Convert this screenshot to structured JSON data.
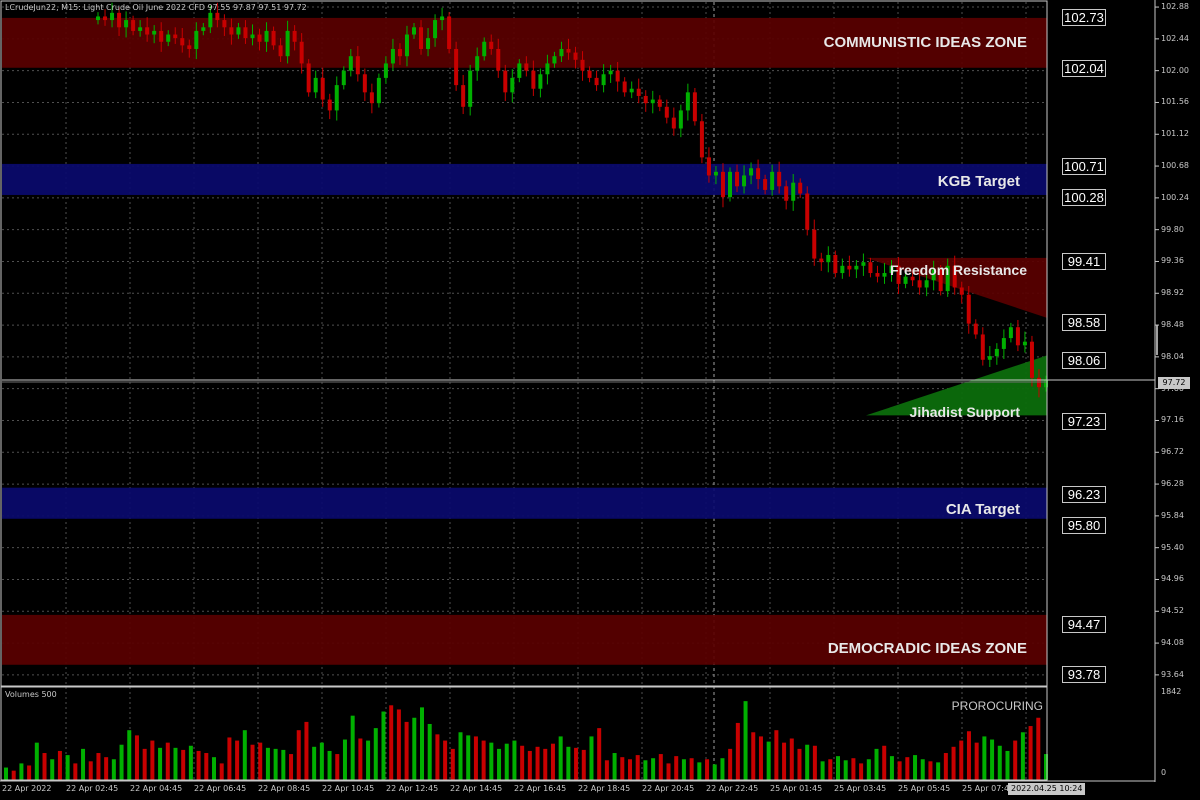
{
  "symbol_info": "LCrudeJun22, M15:  Light Crude Oil June 2022 CFD  97.55 97.87 97.51 97.72",
  "zones": [
    {
      "id": "communistic",
      "label": "COMMUNISTIC IDEAS ZONE",
      "color": "#5a0000",
      "price_top": 102.73,
      "price_bottom": 102.04
    },
    {
      "id": "kgb",
      "label": "KGB Target",
      "color": "#0a0a6e",
      "price_top": 100.71,
      "price_bottom": 100.28
    },
    {
      "id": "cia",
      "label": "CIA Target",
      "color": "#0a0a6e",
      "price_top": 96.23,
      "price_bottom": 95.8
    },
    {
      "id": "democradic",
      "label": "DEMOCRADIC IDEAS ZONE",
      "color": "#5a0000",
      "price_top": 94.47,
      "price_bottom": 93.78
    }
  ],
  "triangles": [
    {
      "id": "freedom",
      "label": "Freedom Resistance",
      "color": "#5a0000",
      "price_top": 99.41,
      "price_bottom": 98.58
    },
    {
      "id": "jihadist",
      "label": "Jihadist Support",
      "color": "#0c6d0c",
      "price_top": 98.06,
      "price_bottom": 97.23
    }
  ],
  "price_labels": [
    "102.73",
    "102.04",
    "100.71",
    "100.28",
    "99.41",
    "98.58",
    "98.06",
    "97.23",
    "96.23",
    "95.80",
    "94.47",
    "93.78"
  ],
  "price_axis": [
    "102.88",
    "102.44",
    "102.00",
    "101.56",
    "101.12",
    "100.68",
    "100.24",
    "99.80",
    "99.36",
    "98.92",
    "98.48",
    "98.04",
    "97.60",
    "97.16",
    "96.72",
    "96.28",
    "95.84",
    "95.40",
    "94.96",
    "94.52",
    "94.08",
    "93.64"
  ],
  "current_price": "97.72",
  "indicator": {
    "label": "Volumes 500",
    "tag": "PROROCURING",
    "axis_top": "1842",
    "axis_bottom": "0"
  },
  "time_axis": [
    "22 Apr 2022",
    "22 Apr 02:45",
    "22 Apr 04:45",
    "22 Apr 06:45",
    "22 Apr 08:45",
    "22 Apr 10:45",
    "22 Apr 12:45",
    "22 Apr 14:45",
    "22 Apr 16:45",
    "22 Apr 18:45",
    "22 Apr 20:45",
    "22 Apr 22:45",
    "25 Apr 01:45",
    "25 Apr 03:45",
    "25 Apr 05:45",
    "25 Apr 07:45"
  ],
  "time_cursor": "2022.04.25 10:24",
  "colors": {
    "up": "#00b000",
    "down": "#c80000",
    "grid": "#505050",
    "axis": "#c8c8c8"
  },
  "chart_data": {
    "type": "candlestick",
    "timeframe": "M15",
    "ylim": [
      93.5,
      102.95
    ],
    "closes": [
      102.75,
      102.7,
      102.8,
      102.6,
      102.7,
      102.55,
      102.6,
      102.5,
      102.55,
      102.4,
      102.5,
      102.45,
      102.35,
      102.3,
      102.55,
      102.6,
      102.8,
      102.7,
      102.6,
      102.5,
      102.6,
      102.45,
      102.5,
      102.4,
      102.55,
      102.35,
      102.2,
      102.55,
      102.4,
      102.1,
      101.7,
      101.9,
      101.6,
      101.45,
      101.8,
      102.0,
      102.2,
      101.95,
      101.7,
      101.55,
      101.9,
      102.1,
      102.3,
      102.2,
      102.5,
      102.6,
      102.3,
      102.45,
      102.7,
      102.75,
      102.3,
      101.8,
      101.5,
      102.0,
      102.2,
      102.4,
      102.3,
      102.0,
      101.7,
      101.9,
      102.1,
      102.0,
      101.75,
      101.95,
      102.1,
      102.2,
      102.3,
      102.25,
      102.15,
      102.0,
      101.9,
      101.8,
      101.95,
      102.0,
      101.85,
      101.7,
      101.75,
      101.65,
      101.55,
      101.6,
      101.5,
      101.35,
      101.2,
      101.45,
      101.7,
      101.3,
      100.8,
      100.55,
      100.6,
      100.25,
      100.6,
      100.4,
      100.55,
      100.65,
      100.5,
      100.35,
      100.6,
      100.4,
      100.2,
      100.45,
      100.3,
      99.8,
      99.4,
      99.35,
      99.45,
      99.2,
      99.3,
      99.25,
      99.3,
      99.35,
      99.2,
      99.15,
      99.2,
      99.3,
      99.05,
      99.15,
      99.1,
      99.0,
      99.1,
      99.25,
      98.95,
      99.3,
      99.0,
      98.9,
      98.5,
      98.35,
      98.0,
      98.05,
      98.15,
      98.3,
      98.45,
      98.2,
      98.25,
      97.75,
      97.62,
      97.72
    ],
    "volumes": [
      120,
      90,
      160,
      140,
      360,
      260,
      200,
      280,
      240,
      160,
      300,
      180,
      260,
      220,
      200,
      340,
      480,
      430,
      300,
      380,
      310,
      360,
      310,
      290,
      330,
      280,
      260,
      220,
      160,
      410,
      380,
      480,
      340,
      360,
      310,
      300,
      290,
      250,
      480,
      560,
      320,
      360,
      280,
      250,
      390,
      620,
      400,
      380,
      500,
      660,
      720,
      680,
      560,
      600,
      700,
      540,
      440,
      380,
      300,
      460,
      430,
      420,
      380,
      360,
      300,
      350,
      380,
      330,
      280,
      320,
      300,
      350,
      420,
      320,
      310,
      290,
      420,
      500,
      190,
      260,
      220,
      200,
      240,
      190,
      210,
      250,
      160,
      230,
      200,
      210,
      170,
      200,
      150,
      210,
      300,
      550,
      760,
      460,
      420,
      370,
      480,
      360,
      400,
      300,
      340,
      330,
      180,
      200,
      230,
      190,
      210,
      160,
      200,
      300,
      330,
      230,
      180,
      220,
      240,
      200,
      180,
      170,
      260,
      320,
      380,
      470,
      360,
      420,
      390,
      330,
      280,
      380,
      460,
      520,
      600,
      250
    ]
  }
}
